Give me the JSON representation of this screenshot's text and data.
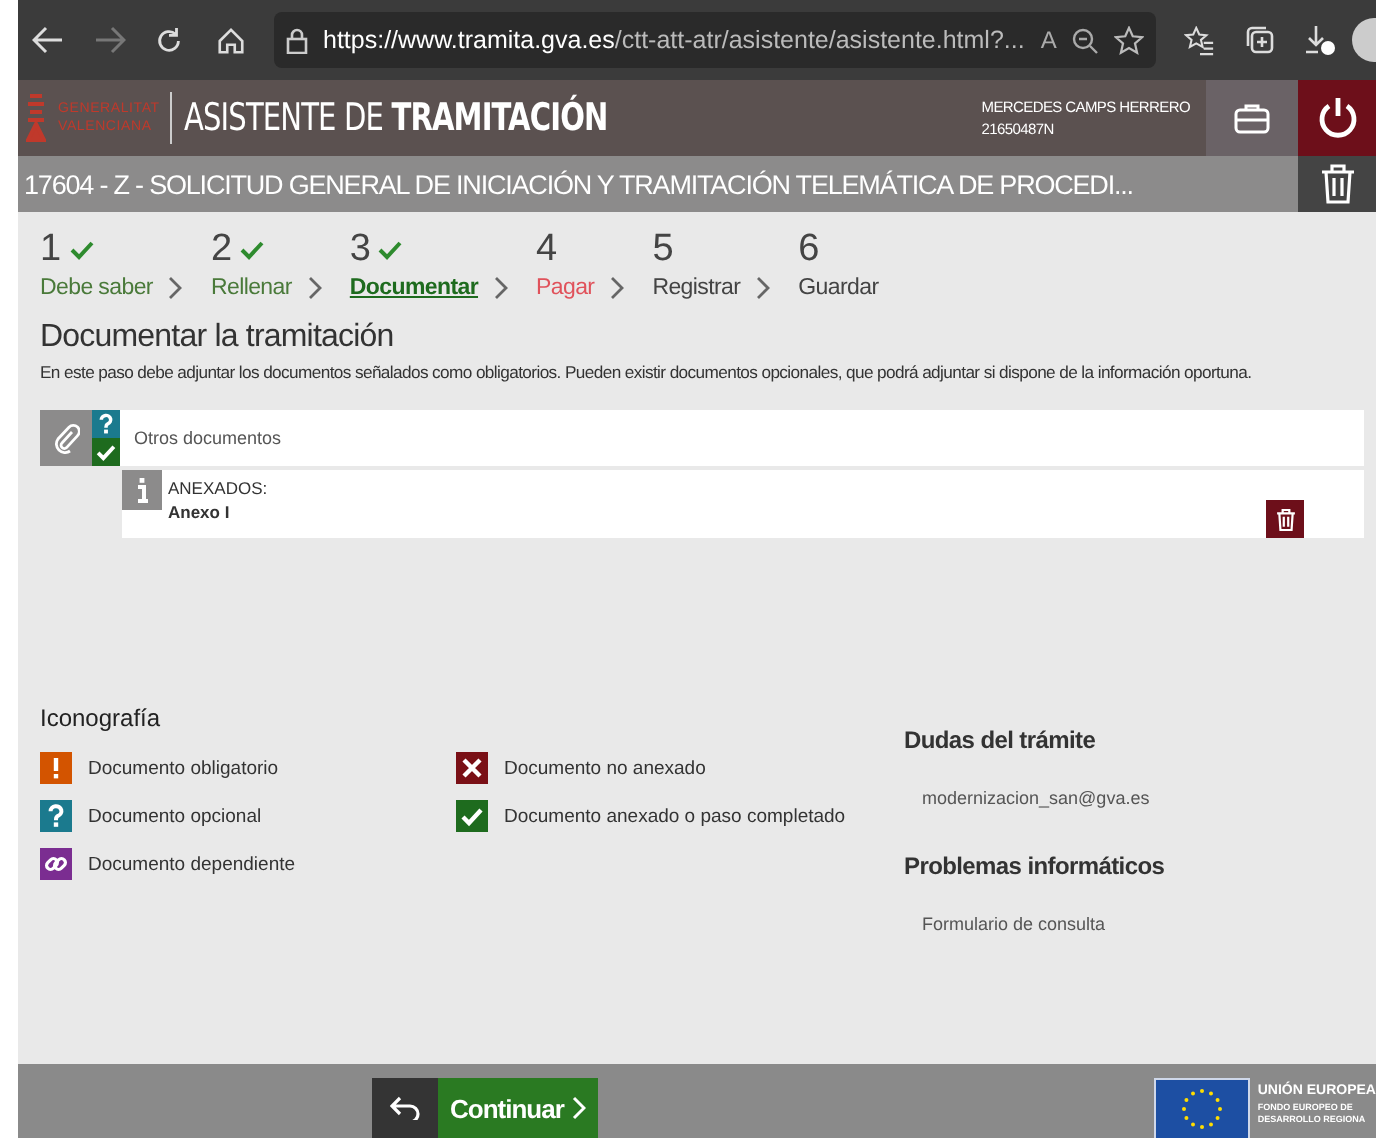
{
  "browser": {
    "url_host": "https://www.tramita.gva.es",
    "url_path": "/ctt-att-atr/asistente/asistente.html?...",
    "read_aloud": "A"
  },
  "header": {
    "logo_line1": "GENERALITAT",
    "logo_line2": "VALENCIANA",
    "title_light": "ASISTENTE DE",
    "title_bold": "TRAMITACIÓN",
    "user_name": "MERCEDES CAMPS HERRERO",
    "user_id": "21650487N"
  },
  "procedure_title": "17604 - Z - SOLICITUD GENERAL DE INICIACIÓN Y TRAMITACIÓN TELEMÁTICA DE PROCEDI...",
  "steps": [
    {
      "number": "1",
      "label": "Debe saber",
      "kind": "done",
      "selected": false
    },
    {
      "number": "2",
      "label": "Rellenar",
      "kind": "done",
      "selected": false
    },
    {
      "number": "3",
      "label": "Documentar",
      "kind": "done",
      "selected": true
    },
    {
      "number": "4",
      "label": "Pagar",
      "kind": "error",
      "selected": false
    },
    {
      "number": "5",
      "label": "Registrar",
      "kind": "pending",
      "selected": false
    },
    {
      "number": "6",
      "label": "Guardar",
      "kind": "pending",
      "selected": false
    }
  ],
  "section": {
    "title": "Documentar la tramitación",
    "description": "En este paso debe adjuntar los documentos señalados como obligatorios. Pueden existir documentos opcionales, que podrá adjuntar si dispone de la información oportuna."
  },
  "documents": [
    {
      "name": "Otros documentos",
      "kind": "optional",
      "attached": true,
      "attachments_label": "ANEXADOS:",
      "attachments": [
        "Anexo I"
      ]
    }
  ],
  "legend": {
    "title": "Iconografía",
    "items": [
      {
        "kind": "mandatory",
        "label": "Documento obligatorio"
      },
      {
        "kind": "optional",
        "label": "Documento opcional"
      },
      {
        "kind": "dependent",
        "label": "Documento dependiente"
      },
      {
        "kind": "missing",
        "label": "Documento no anexado"
      },
      {
        "kind": "attached",
        "label": "Documento anexado o paso completado"
      }
    ]
  },
  "help": [
    {
      "title": "Dudas del trámite",
      "link": "modernizacion_san@gva.es"
    },
    {
      "title": "Problemas informáticos",
      "link": "Formulario de consulta"
    }
  ],
  "footer": {
    "continue_label": "Continuar",
    "eu_title": "UNIÓN EUROPEA",
    "eu_line1": "FONDO EUROPEO DE",
    "eu_line2": "DESARROLLO REGIONA"
  }
}
